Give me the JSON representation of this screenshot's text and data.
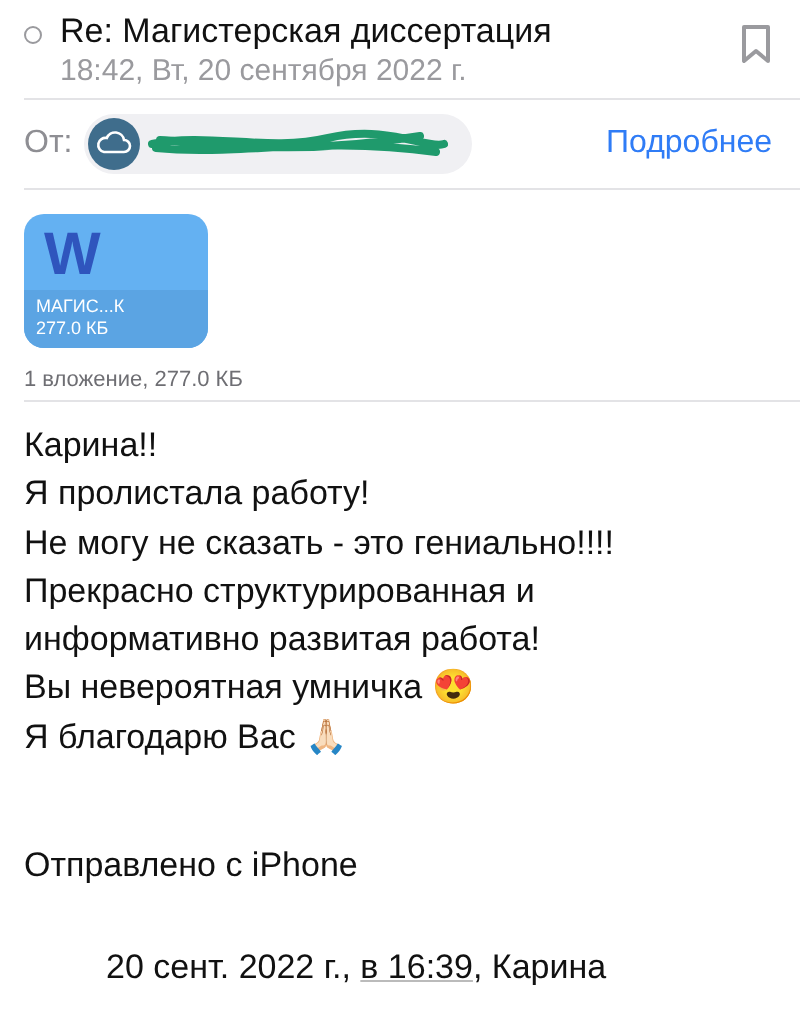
{
  "header": {
    "subject": "Re: Магистерская диссертация",
    "date": "18:42, Вт, 20 сентября 2022 г.",
    "unread": false,
    "flagged": false
  },
  "sender": {
    "label": "От:",
    "details_link": "Подробнее",
    "redacted": true
  },
  "attachment": {
    "icon_letter": "W",
    "name": "МАГИС...К",
    "size": "277.0 КБ",
    "summary": "1 вложение, 277.0 КБ"
  },
  "body": [
    "Карина!!",
    "Я пролистала работу!",
    "Не могу не сказать - это гениально!!!!",
    "Прекрасно структурированная и",
    "информативно развитая работа!",
    "Вы невероятная умничка 😍",
    "Я благодарю Вас 🙏🏻"
  ],
  "signature": "Отправлено с iPhone",
  "quote": {
    "before": "20 сент. 2022 г., ",
    "link": "в 16:39",
    "after": ", Карина"
  }
}
